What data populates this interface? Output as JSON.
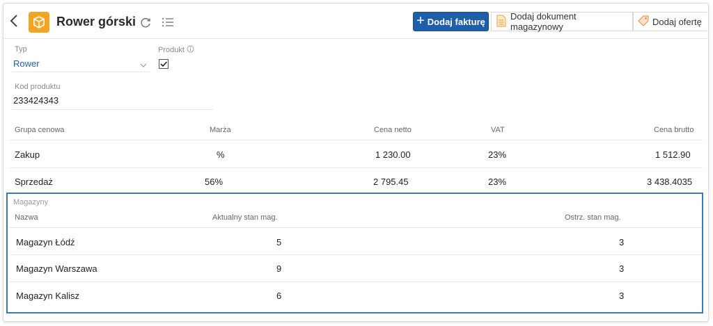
{
  "header": {
    "title": "Rower górski",
    "btn_add_invoice": "Dodaj fakturę",
    "btn_add_warehouse_doc": "Dodaj dokument magazynowy",
    "btn_add_offer": "Dodaj ofertę"
  },
  "form": {
    "type_label": "Typ",
    "type_value": "Rower",
    "product_label": "Produkt",
    "product_checked": true,
    "code_label": "Kod produktu",
    "code_value": "233424343"
  },
  "pricing": {
    "headers": [
      "Grupa cenowa",
      "Marża",
      "Cena netto",
      "VAT",
      "Cena brutto"
    ],
    "rows": [
      [
        "Zakup",
        "%",
        "1 230.00",
        "23%",
        "1 512.90"
      ],
      [
        "Sprzedaż",
        "56%",
        "2 795.45",
        "23%",
        "3 438.4035"
      ]
    ]
  },
  "warehouses": {
    "section_label": "Magazyny",
    "headers": [
      "Nazwa",
      "Aktualny stan mag.",
      "Ostrz. stan mag."
    ],
    "rows": [
      [
        "Magazyn Łódź",
        "5",
        "3"
      ],
      [
        "Magazyn Warszawa",
        "9",
        "3"
      ],
      [
        "Magazyn Kalisz",
        "6",
        "3"
      ]
    ]
  },
  "colors": {
    "accent_blue": "#1f5fa8",
    "app_icon_orange": "#f5a524",
    "highlight_border": "#3a78c2"
  }
}
